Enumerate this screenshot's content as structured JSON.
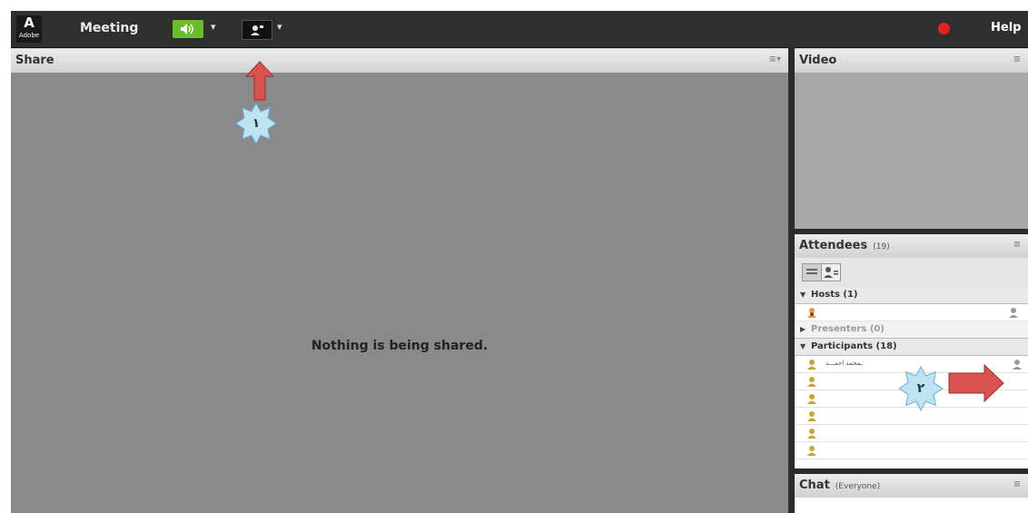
{
  "topbar": {
    "logo_mark": "A",
    "logo_text": "Adobe",
    "menu_meeting": "Meeting",
    "dropdown_caret": "▾",
    "help_label": "Help",
    "record_color": "#e32222",
    "speaker_color": "#6bbd2c"
  },
  "share_pod": {
    "title": "Share",
    "menu_icon": "≡▾",
    "empty_message": "Nothing is being shared."
  },
  "video_pod": {
    "title": "Video"
  },
  "attendees_pod": {
    "title": "Attendees",
    "count": "(19)",
    "sections": {
      "hosts": "Hosts (1)",
      "presenters": "Presenters (0)",
      "participants": "Participants (18)"
    },
    "participant_first_name": "ـمحمد احمـــد"
  },
  "chat_pod": {
    "title": "Chat",
    "scope": "(Everyone)"
  },
  "annotations": {
    "marker_1": "١",
    "marker_2": "٢"
  }
}
